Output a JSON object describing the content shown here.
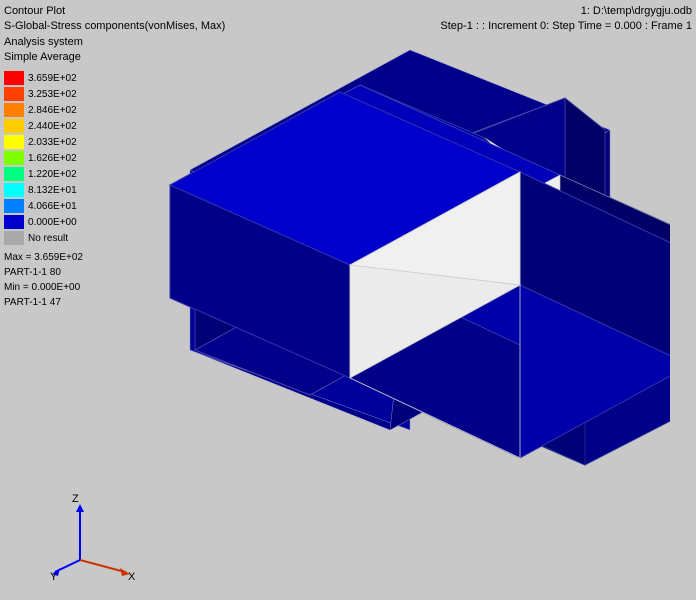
{
  "header": {
    "plot_type": "Contour Plot",
    "variable": "S-Global-Stress components(vonMises, Max)",
    "system": "Analysis system",
    "averaging": "Simple Average",
    "file_ref": "1: D:\\temp\\drgygju.odb",
    "step_info": "Step-1 : : Increment   0: Step Time =   0.000 : Frame 1"
  },
  "legend": {
    "values": [
      {
        "label": "3.659E+02",
        "color": "#FF0000"
      },
      {
        "label": "3.253E+02",
        "color": "#FF4000"
      },
      {
        "label": "2.846E+02",
        "color": "#FF8000"
      },
      {
        "label": "2.440E+02",
        "color": "#FFCC00"
      },
      {
        "label": "2.033E+02",
        "color": "#FFFF00"
      },
      {
        "label": "1.626E+02",
        "color": "#80FF00"
      },
      {
        "label": "1.220E+02",
        "color": "#00FF80"
      },
      {
        "label": "8.132E+01",
        "color": "#00FFFF"
      },
      {
        "label": "4.066E+01",
        "color": "#0080FF"
      },
      {
        "label": "0.000E+00",
        "color": "#0000CC"
      }
    ],
    "no_result_label": "No result",
    "max_label": "Max = 3.659E+02",
    "max_location": "PART-1-1 80",
    "min_label": "Min = 0.000E+00",
    "min_location": "PART-1-1 47"
  },
  "axes": {
    "x_label": "X",
    "y_label": "Y",
    "z_label": "Z"
  }
}
